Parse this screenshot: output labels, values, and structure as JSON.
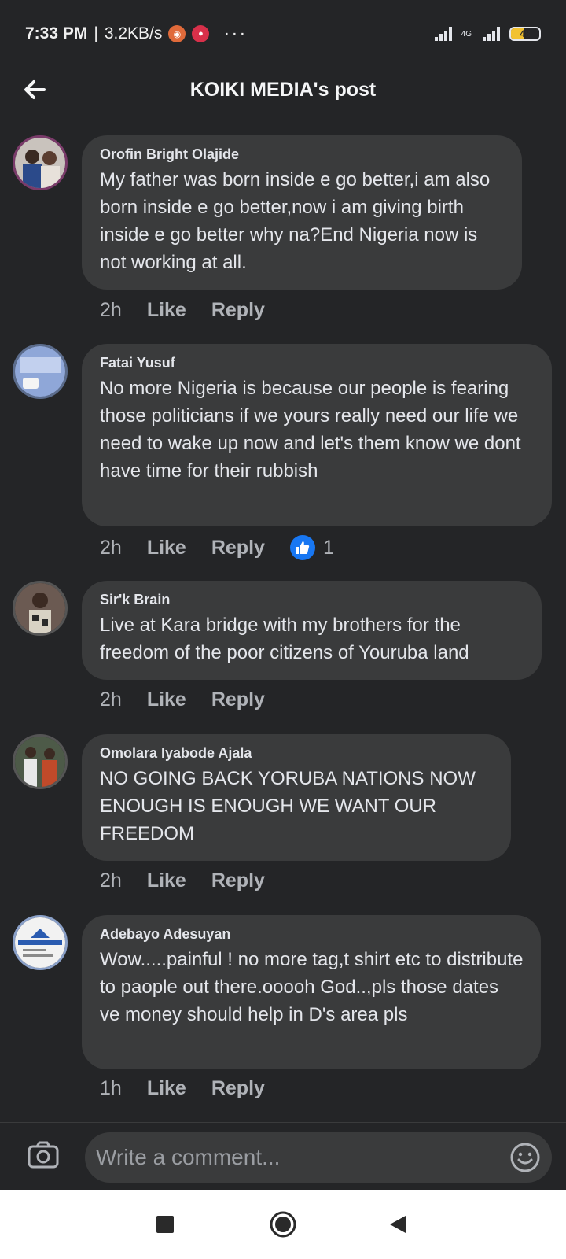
{
  "status_bar": {
    "time": "7:33 PM",
    "separator": "|",
    "net_speed": "3.2KB/s",
    "more": "···",
    "network_type": "4G",
    "battery_level": "48",
    "battery_fraction": 0.48
  },
  "header": {
    "title": "KOIKI MEDIA's post",
    "back_icon": "arrow-left-icon"
  },
  "comments": [
    {
      "author": "Orofin Bright Olajide",
      "text": "My father was born inside e go better,i am also born inside e go better,now i am giving birth inside e go better why na?End Nigeria now is not working at all.",
      "time": "2h",
      "like_label": "Like",
      "reply_label": "Reply"
    },
    {
      "author": "Fatai Yusuf",
      "text": "No more Nigeria is because our people is fearing those politicians if we yours really need our life we need to wake up now and let's them know we dont have time for their rubbish",
      "time": "2h",
      "like_label": "Like",
      "reply_label": "Reply",
      "reaction_count": "1",
      "reaction_icon": "thumbs-up-icon"
    },
    {
      "author": "Sir'k Brain",
      "text": "Live at Kara bridge with my brothers for the freedom of the poor citizens of Youruba land",
      "time": "2h",
      "like_label": "Like",
      "reply_label": "Reply"
    },
    {
      "author": "Omolara Iyabode Ajala",
      "text": "NO GOING BACK YORUBA NATIONS NOW ENOUGH IS ENOUGH WE WANT OUR FREEDOM",
      "time": "2h",
      "like_label": "Like",
      "reply_label": "Reply"
    },
    {
      "author": "Adebayo Adesuyan",
      "text": "Wow.....painful ! no more tag,t shirt etc to distribute to paople out there.ooooh God..,pls those dates ve money should help in D's area pls",
      "time": "1h",
      "like_label": "Like",
      "reply_label": "Reply"
    }
  ],
  "composer": {
    "placeholder": "Write a comment...",
    "camera_icon": "camera-icon",
    "emoji_icon": "emoji-icon"
  },
  "navbar": {
    "recents_icon": "square-icon",
    "home_icon": "circle-icon",
    "back_icon": "triangle-back-icon"
  },
  "colors": {
    "background": "#242527",
    "bubble": "#3a3b3c",
    "text": "#e4e6eb",
    "secondary_text": "#b0b3b8",
    "like_blue": "#1877f2",
    "battery": "#f2c230"
  }
}
